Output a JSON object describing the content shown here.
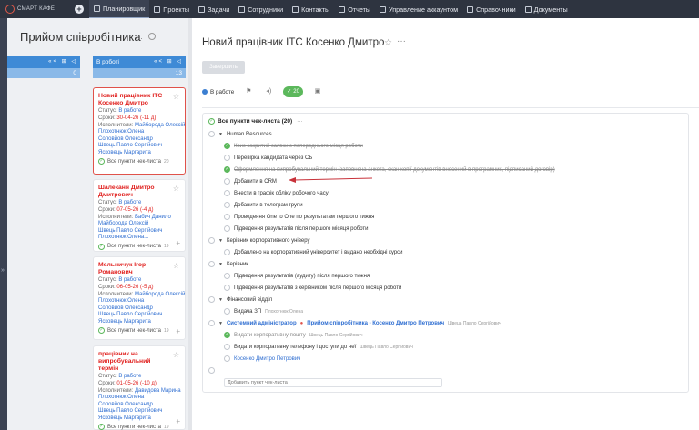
{
  "app": {
    "logo_text": "СМАРТ КАФЕ",
    "plus": "+"
  },
  "nav": [
    {
      "label": "Планировщик",
      "icon": "calendar-icon",
      "active": true
    },
    {
      "label": "Проекты",
      "icon": "folder-icon"
    },
    {
      "label": "Задачи",
      "icon": "tasks-icon"
    },
    {
      "label": "Сотрудники",
      "icon": "users-icon"
    },
    {
      "label": "Контакты",
      "icon": "contacts-icon"
    },
    {
      "label": "Отчеты",
      "icon": "reports-icon"
    },
    {
      "label": "Управление аккаунтом",
      "icon": "settings-icon"
    },
    {
      "label": "Справочники",
      "icon": "book-icon"
    },
    {
      "label": "Документы",
      "icon": "document-icon"
    }
  ],
  "board": {
    "title": "Прийом співробітника",
    "dots": "···",
    "col_left": {
      "count": "0"
    },
    "col_right": {
      "name": "В роботі",
      "count": "13",
      "icons": "«< ⊞ ◁"
    },
    "cards": [
      {
        "title": "Новий працівник ІТС Косенко Дмитро",
        "status_label": "Статус:",
        "status": "В работе",
        "due_label": "Сроки:",
        "due": "30-04-26",
        "due_delta": "(-11 д)",
        "exec_label": "Исполнители:",
        "exec": "Майборода Олексій",
        "people": [
          "Плохотнюк Олена",
          "Соловйов Олександр",
          "Швець Павло Сергійович",
          "Ясковець Маргарита"
        ],
        "check": "Все пункти чек-листа",
        "check_n": "20"
      },
      {
        "title": "Шалеканн Дмитро Дмитрович",
        "status_label": "Статус:",
        "status": "В работе",
        "due_label": "Сроки:",
        "due": "07-05-26",
        "due_delta": "(-4 д)",
        "exec_label": "Исполнители:",
        "exec": "Бабич Данило",
        "people": [
          "Майборода Олексій",
          "Швець Павло Сергійович",
          "Плохотнюк Олена..."
        ],
        "check": "Все пункти чек-листа",
        "check_n": "19"
      },
      {
        "title": "Мельничук Ігор Романович",
        "status_label": "Статус:",
        "status": "В работе",
        "due_label": "Сроки:",
        "due": "06-05-26",
        "due_delta": "(-5 д)",
        "exec_label": "Исполнители:",
        "exec": "Майборода Олексій",
        "people": [
          "Плохотнюк Олена",
          "Соловйов Олександр",
          "Швець Павло Сергійович",
          "Ясковець Маргарита"
        ],
        "check": "Все пункти чек-листа",
        "check_n": "19"
      },
      {
        "title": "працівник на випробувальний термін",
        "status_label": "Статус:",
        "status": "В работе",
        "due_label": "Сроки:",
        "due": "01-05-26",
        "due_delta": "(-10 д)",
        "exec_label": "Исполнители:",
        "exec": "Давидова Марина",
        "people": [
          "Плохотнюк Олена",
          "Соловйов Олександр",
          "Швець Павло Сергійович",
          "Ясковець Маргарита"
        ],
        "check": "Все пункти чек-листа",
        "check_n": "19"
      }
    ]
  },
  "task": {
    "title": "Новий працівник ІТС Косенко Дмитро",
    "finish": "Завершить",
    "status": "В работе",
    "green_count": "20",
    "checklist_title": "Все пункти чек-листа (20)",
    "dots": "···",
    "items": [
      {
        "kind": "group",
        "label": "Human Resources"
      },
      {
        "kind": "done-strike",
        "label": "Квиз закритий заявки з попереднього місця роботи"
      },
      {
        "kind": "todo",
        "label": "Перевірка кандидата через СБ"
      },
      {
        "kind": "done-strike",
        "label": "Оформлення на випробувальний термін (заповнена анкета, скан копії документів внесений в програмних, підписаний договір)"
      },
      {
        "kind": "todo",
        "label": "Добавити в CRM"
      },
      {
        "kind": "todo",
        "label": "Внести в графік обліку робочого часу"
      },
      {
        "kind": "todo",
        "label": "Добавити в телеграм групи"
      },
      {
        "kind": "todo",
        "label": "Проведення One to One по результатам першого тижня"
      },
      {
        "kind": "todo",
        "label": "Підведення результатів після першого місяця роботи"
      },
      {
        "kind": "group",
        "label": "Керівник корпоративного універу"
      },
      {
        "kind": "todo",
        "label": "Добавлено на корпоративний університет і видано необхідні курси"
      },
      {
        "kind": "group",
        "label": "Керівник"
      },
      {
        "kind": "todo",
        "label": "Підведення результатів (аудиту) після першого тижня"
      },
      {
        "kind": "todo",
        "label": "Підведення результатів з керівником після першого місяця роботи"
      },
      {
        "kind": "group",
        "label": "Фінансовий відділ"
      },
      {
        "kind": "todo",
        "label": "Видача ЗП",
        "who": "Плохотнюк Олена"
      },
      {
        "kind": "sysgroup",
        "label": "Системний адміністратор",
        "extra": "Прийом співробітника - Косенко Дмитро Петрович",
        "who": "Швець Павло Сергійович"
      },
      {
        "kind": "done-strike",
        "label": "Видати корпоративну пошту",
        "who": "Швець Павло Сергійович"
      },
      {
        "kind": "todo",
        "label": "Видати корпоративну телефону і доступи до неї",
        "who": "Швець Павло Сергійович"
      },
      {
        "kind": "link",
        "label": "Косенко Дмитро Петрович"
      }
    ],
    "add_placeholder": "Добавить пункт чек-листа"
  }
}
